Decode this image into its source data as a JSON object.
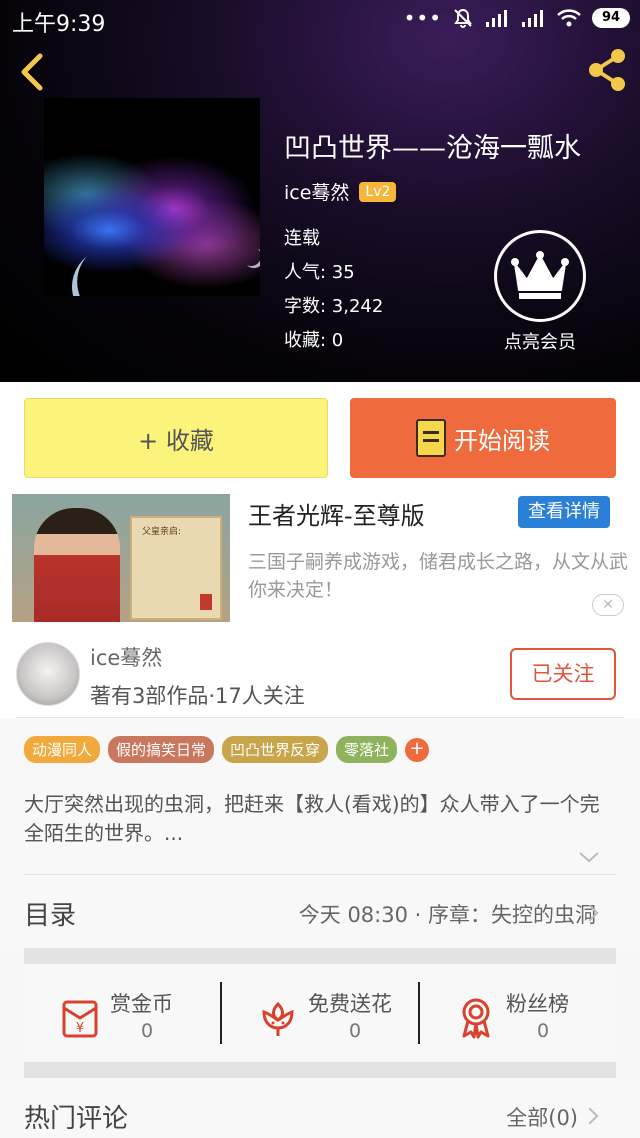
{
  "status_bar": {
    "time": "上午9:39",
    "battery": "94"
  },
  "book": {
    "title": "凹凸世界——沧海一瓢水",
    "author": "ice蓦然",
    "level": "Lv2",
    "status": "连载",
    "popularity": "人气: 35",
    "word_count": "字数: 3,242",
    "favorites": "收藏: 0"
  },
  "vip": {
    "label": "点亮会员"
  },
  "actions": {
    "collect_label": "+ 收藏",
    "read_label": "开始阅读"
  },
  "ad": {
    "title": "王者光辉-至尊版",
    "detail_label": "查看详情",
    "description": "三国子嗣养成游戏，储君成长之路，从文从武你来决定！",
    "image_text": "父皇亲启:",
    "close_label": "✕"
  },
  "author_card": {
    "name": "ice蓦然",
    "meta": "著有3部作品·17人关注",
    "follow_label": "已关注"
  },
  "tags": [
    {
      "label": "动漫同人",
      "color": "#f2a93b"
    },
    {
      "label": "假的搞笑日常",
      "color": "#c9775f"
    },
    {
      "label": "凹凸世界反穿",
      "color": "#c8a44a"
    },
    {
      "label": "零落社",
      "color": "#8fb35d"
    }
  ],
  "tag_add": {
    "label": "+",
    "color": "#ef6a3d"
  },
  "intro": {
    "text": "大厅突然出现的虫洞，把赶来【救人(看戏)的】众人带入了一个完全陌生的世界。..."
  },
  "catalog": {
    "label": "目录",
    "latest": "今天 08:30 · 序章：失控的虫洞"
  },
  "rewards": [
    {
      "title": "赏金币",
      "value": "0",
      "icon": "red-envelope-icon"
    },
    {
      "title": "免费送花",
      "value": "0",
      "icon": "flower-icon"
    },
    {
      "title": "粉丝榜",
      "value": "0",
      "icon": "ribbon-badge-icon"
    }
  ],
  "hot_comments": {
    "label": "热门评论",
    "all": "全部(0)"
  },
  "colors": {
    "accent": "#ef6a3d",
    "collect_bg": "#fbf37c",
    "detail_btn": "#2a7fd6",
    "icon_red": "#d9412c"
  }
}
